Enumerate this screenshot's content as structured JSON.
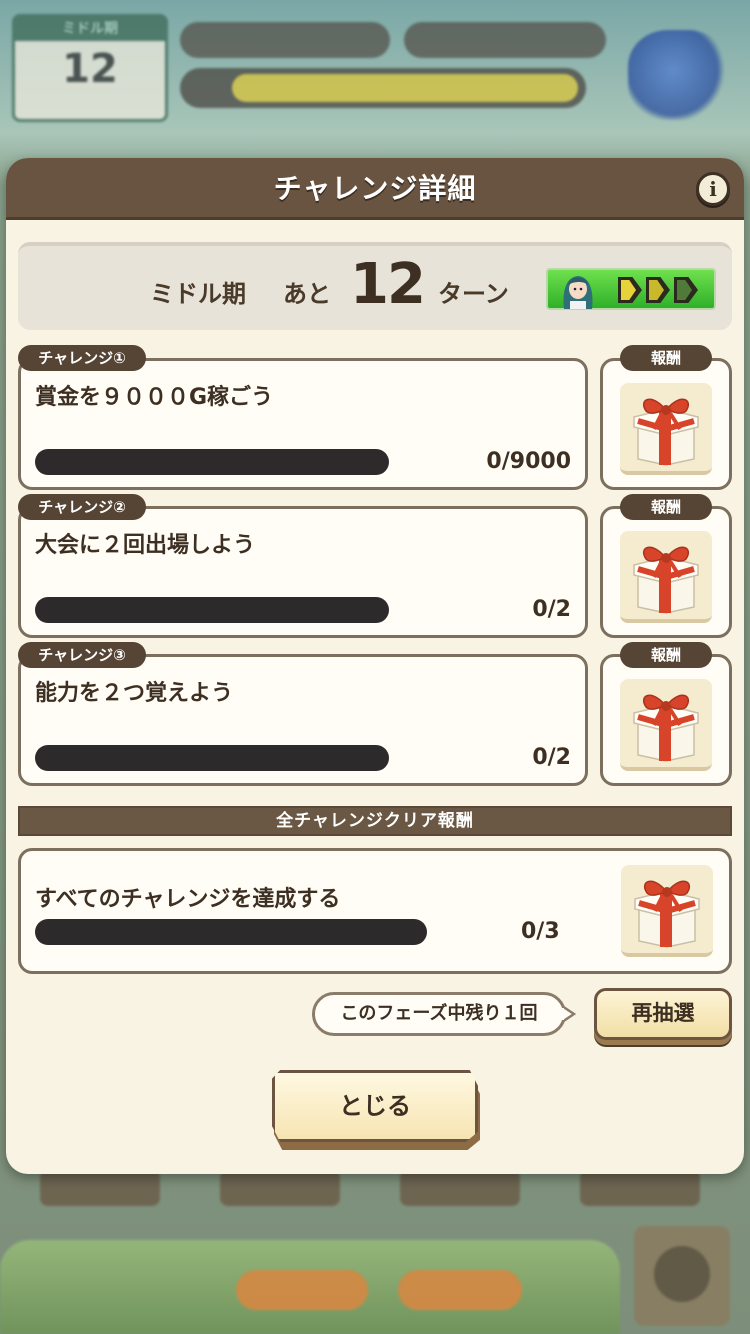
{
  "background": {
    "turn_box_header": "ミドル期",
    "turn_number": "12"
  },
  "modal": {
    "title": "チャレンジ詳細",
    "info_label": "i",
    "period": {
      "phase_name": "ミドル期",
      "remaining_prefix": "あと",
      "remaining_turns": "12",
      "remaining_suffix": "ターン",
      "phase_colors": [
        "#e8d23a",
        "#c8b82a",
        "#4f7a3a"
      ]
    },
    "challenges": [
      {
        "tag": "チャレンジ①",
        "text": "賞金を９０００G稼ごう",
        "progress": "0/9000",
        "progress_value": 0,
        "reward_tag": "報酬",
        "reward_icon": "gift-box-icon"
      },
      {
        "tag": "チャレンジ②",
        "text": "大会に２回出場しよう",
        "progress": "0/2",
        "progress_value": 0,
        "reward_tag": "報酬",
        "reward_icon": "gift-box-icon"
      },
      {
        "tag": "チャレンジ③",
        "text": "能力を２つ覚えよう",
        "progress": "0/2",
        "progress_value": 0,
        "reward_tag": "報酬",
        "reward_icon": "gift-box-icon"
      }
    ],
    "all_clear": {
      "header": "全チャレンジクリア報酬",
      "text": "すべてのチャレンジを達成する",
      "progress": "0/3",
      "progress_value": 0,
      "reward_icon": "gift-box-icon"
    },
    "reroll": {
      "remaining_text": "このフェーズ中残り１回",
      "button_label": "再抽選"
    },
    "close_label": "とじる"
  },
  "colors": {
    "header_brown": "#685440",
    "card_border": "#7d6f5e",
    "track_dark": "#2c2a2a",
    "gift_red": "#d8442a"
  }
}
